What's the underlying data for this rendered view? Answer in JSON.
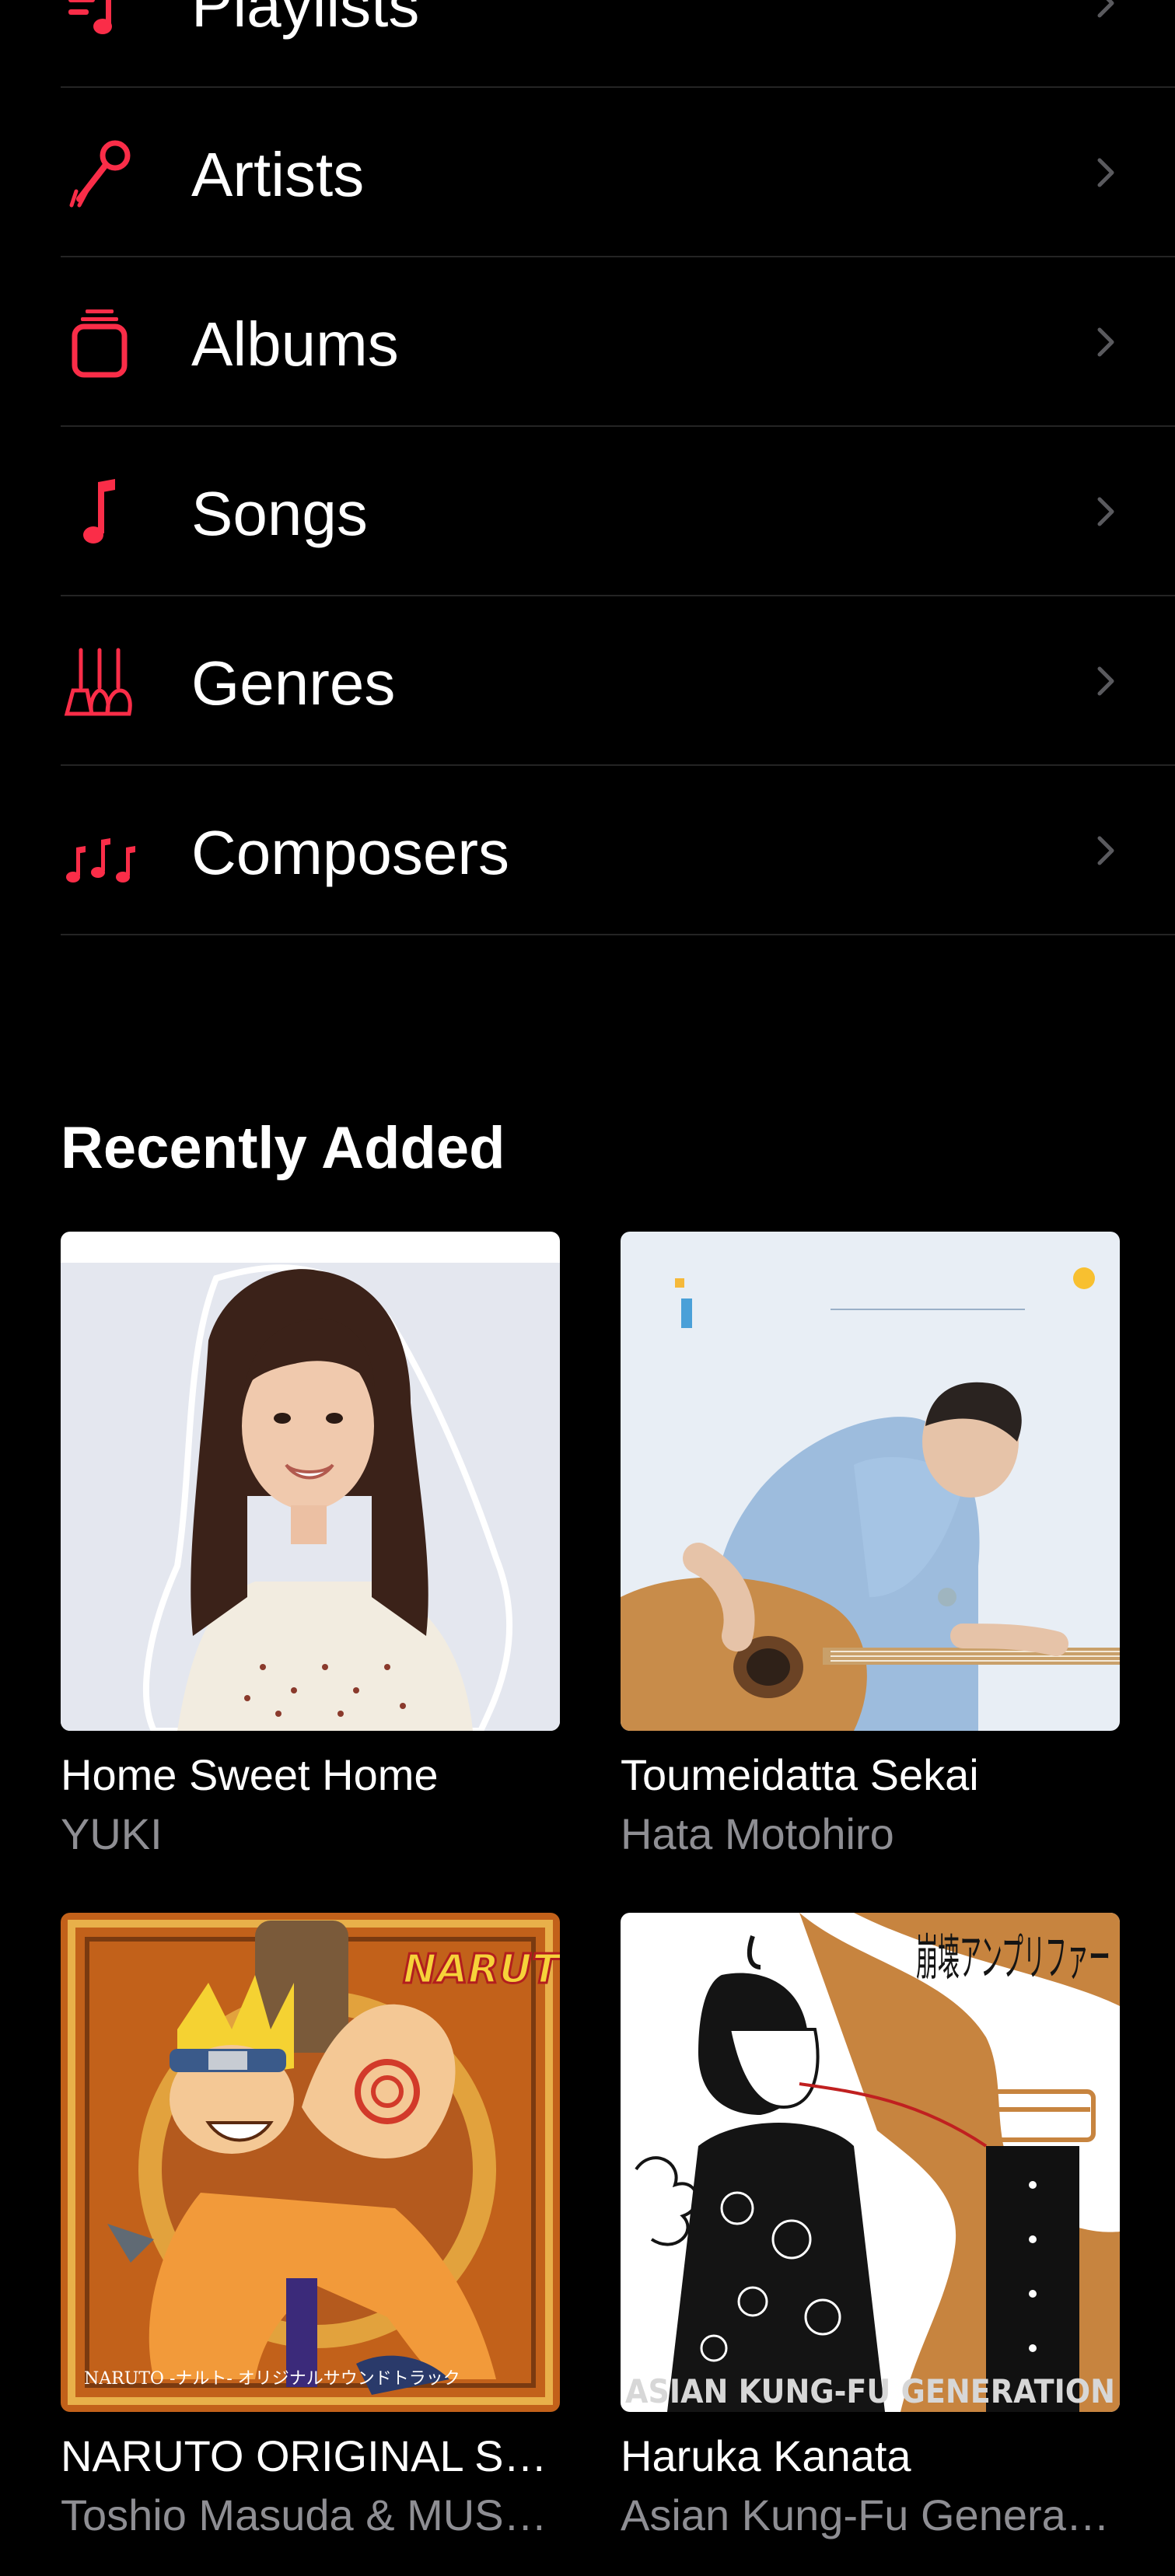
{
  "library": {
    "accent_color": "#fa2d48",
    "items": [
      {
        "label": "Playlists",
        "icon": "playlist-icon"
      },
      {
        "label": "Artists",
        "icon": "microphone-icon"
      },
      {
        "label": "Albums",
        "icon": "album-stack-icon"
      },
      {
        "label": "Songs",
        "icon": "music-note-icon"
      },
      {
        "label": "Genres",
        "icon": "guitars-icon"
      },
      {
        "label": "Composers",
        "icon": "music-notes-icon"
      }
    ]
  },
  "recently_added": {
    "title": "Recently Added",
    "albums": [
      {
        "title": "Home Sweet Home",
        "artist": "YUKI",
        "cover": "portrait-woman-cover"
      },
      {
        "title": "Toumeidatta Sekai",
        "artist": "Hata Motohiro",
        "cover": "man-guitar-cover"
      },
      {
        "title": "NARUTO ORIGINAL SOUNDTRACK",
        "artist": "Toshio Masuda & MUSASHI PROJECT",
        "cover": "naruto-cover",
        "cover_text": "NARUTO",
        "cover_caption": "NARUTO -ナルト- オリジナルサウンドトラック"
      },
      {
        "title": "Haruka Kanata",
        "artist": "Asian Kung-Fu Generation",
        "cover": "illustrated-girl-cover",
        "cover_text": "崩壊アンプリファー",
        "cover_caption": "ASIAN KUNG-FU GENERATION"
      }
    ]
  }
}
